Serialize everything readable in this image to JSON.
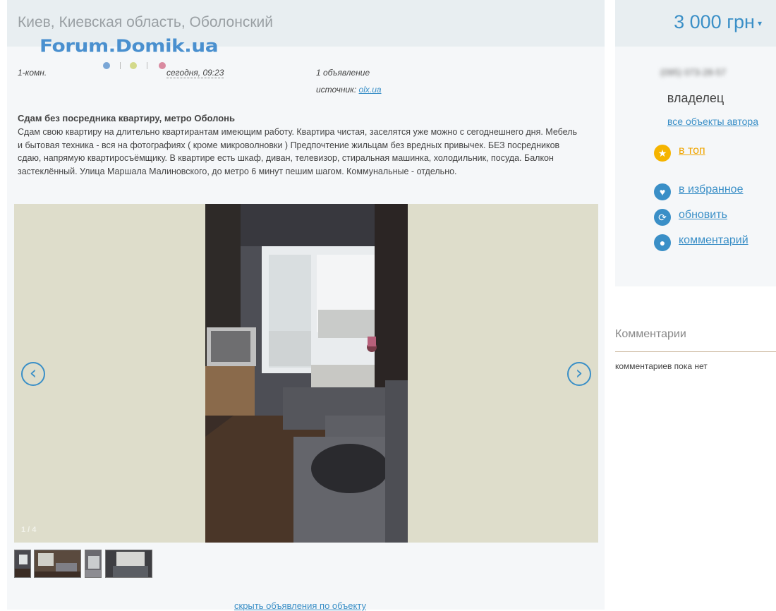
{
  "header": {
    "address": "Киев, Киевская область, Оболонский",
    "logo_text": "Forum.Domik.ua"
  },
  "meta": {
    "rooms": "1-комн.",
    "date": "сегодня, 09:23",
    "listings_count": "1 объявление",
    "source_label": "источник:",
    "source_link": "olx.ua"
  },
  "description": {
    "title": "Сдам без посредника квартиру, метро Оболонь",
    "body": "Сдам свою квартиру на длительно квартирантам имеющим работу. Квартира чистая, заселятся уже можно с сегоднешнего дня. Мебель и бытовая техника - вся на фотографиях ( кроме микроволновки ) Предпочтение жильцам без вредных привычек. БЕЗ посредников сдаю, напрямую квартиросъёмщику. В квартире есть шкаф, диван, телевизор, стиральная машинка, холодильник, посуда. Балкон застеклённый. Улица Маршала Малиновского, до метро 6 минут пешим шагом. Коммунальные - отдельно."
  },
  "gallery": {
    "counter": "1 / 4",
    "prev_icon": "‹",
    "next_icon": "›",
    "background_color": "#deddcb"
  },
  "hide_link": "скрыть объявления по объекту",
  "sidebar": {
    "price": "3 000 грн",
    "price_arrow": "▾",
    "phone": "(095) 073-28-57",
    "owner": "владелец",
    "author_link": "все объекты автора",
    "actions": {
      "top": "в топ",
      "favorite": "в избранное",
      "refresh": "обновить",
      "comment": "комментарий"
    },
    "accent_color": "#3a8fc7",
    "top_color": "#f5b400"
  },
  "comments": {
    "title": "Комментарии",
    "empty": "комментариев пока нет"
  }
}
